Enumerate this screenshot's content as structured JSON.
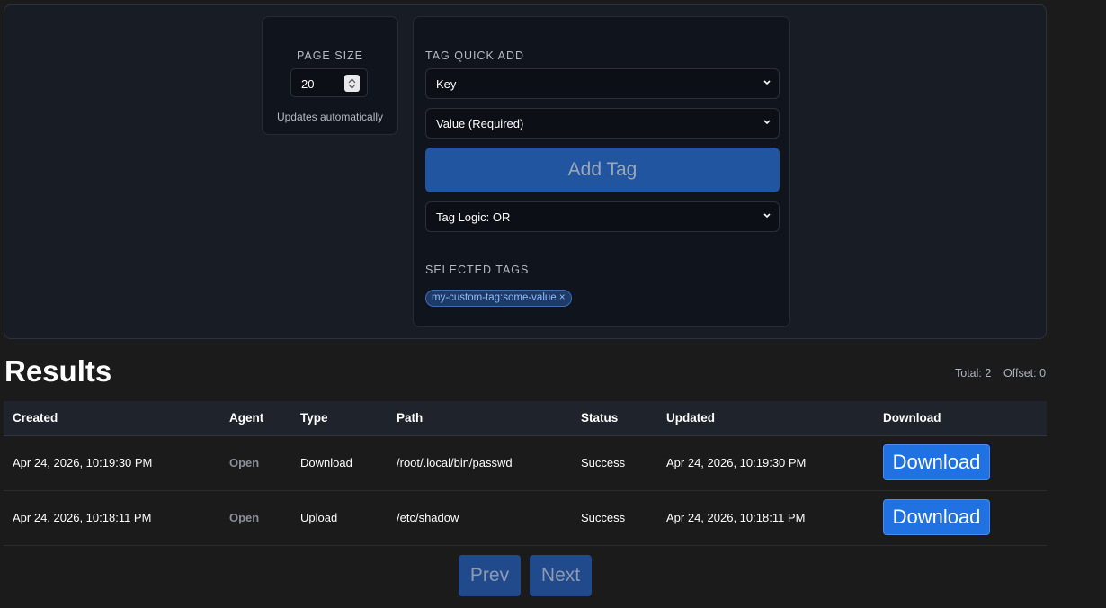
{
  "page_size": {
    "label": "PAGE SIZE",
    "value": "20",
    "hint": "Updates automatically"
  },
  "tag_quick_add": {
    "label": "TAG QUICK ADD",
    "key_select": "Key",
    "value_select": "Value (Required)",
    "add_button": "Add Tag",
    "logic_select": "Tag Logic: OR",
    "selected_label": "SELECTED TAGS",
    "selected_tags": [
      "my-custom-tag:some-value ×"
    ]
  },
  "results": {
    "title": "Results",
    "total": "Total: 2",
    "offset": "Offset: 0",
    "columns": [
      "Created",
      "Agent",
      "Type",
      "Path",
      "Status",
      "Updated",
      "Download"
    ],
    "rows": [
      {
        "created": "Apr 24, 2026, 10:19:30 PM",
        "agent": "Open",
        "type": "Download",
        "path": "/root/.local/bin/passwd",
        "status": "Success",
        "updated": "Apr 24, 2026, 10:19:30 PM",
        "download": "Download"
      },
      {
        "created": "Apr 24, 2026, 10:18:11 PM",
        "agent": "Open",
        "type": "Upload",
        "path": "/etc/shadow",
        "status": "Success",
        "updated": "Apr 24, 2026, 10:18:11 PM",
        "download": "Download"
      }
    ]
  },
  "pagination": {
    "prev": "Prev",
    "next": "Next"
  },
  "colors": {
    "accent": "#2072e3",
    "background": "#1b1b1b",
    "panel": "#181c24"
  }
}
